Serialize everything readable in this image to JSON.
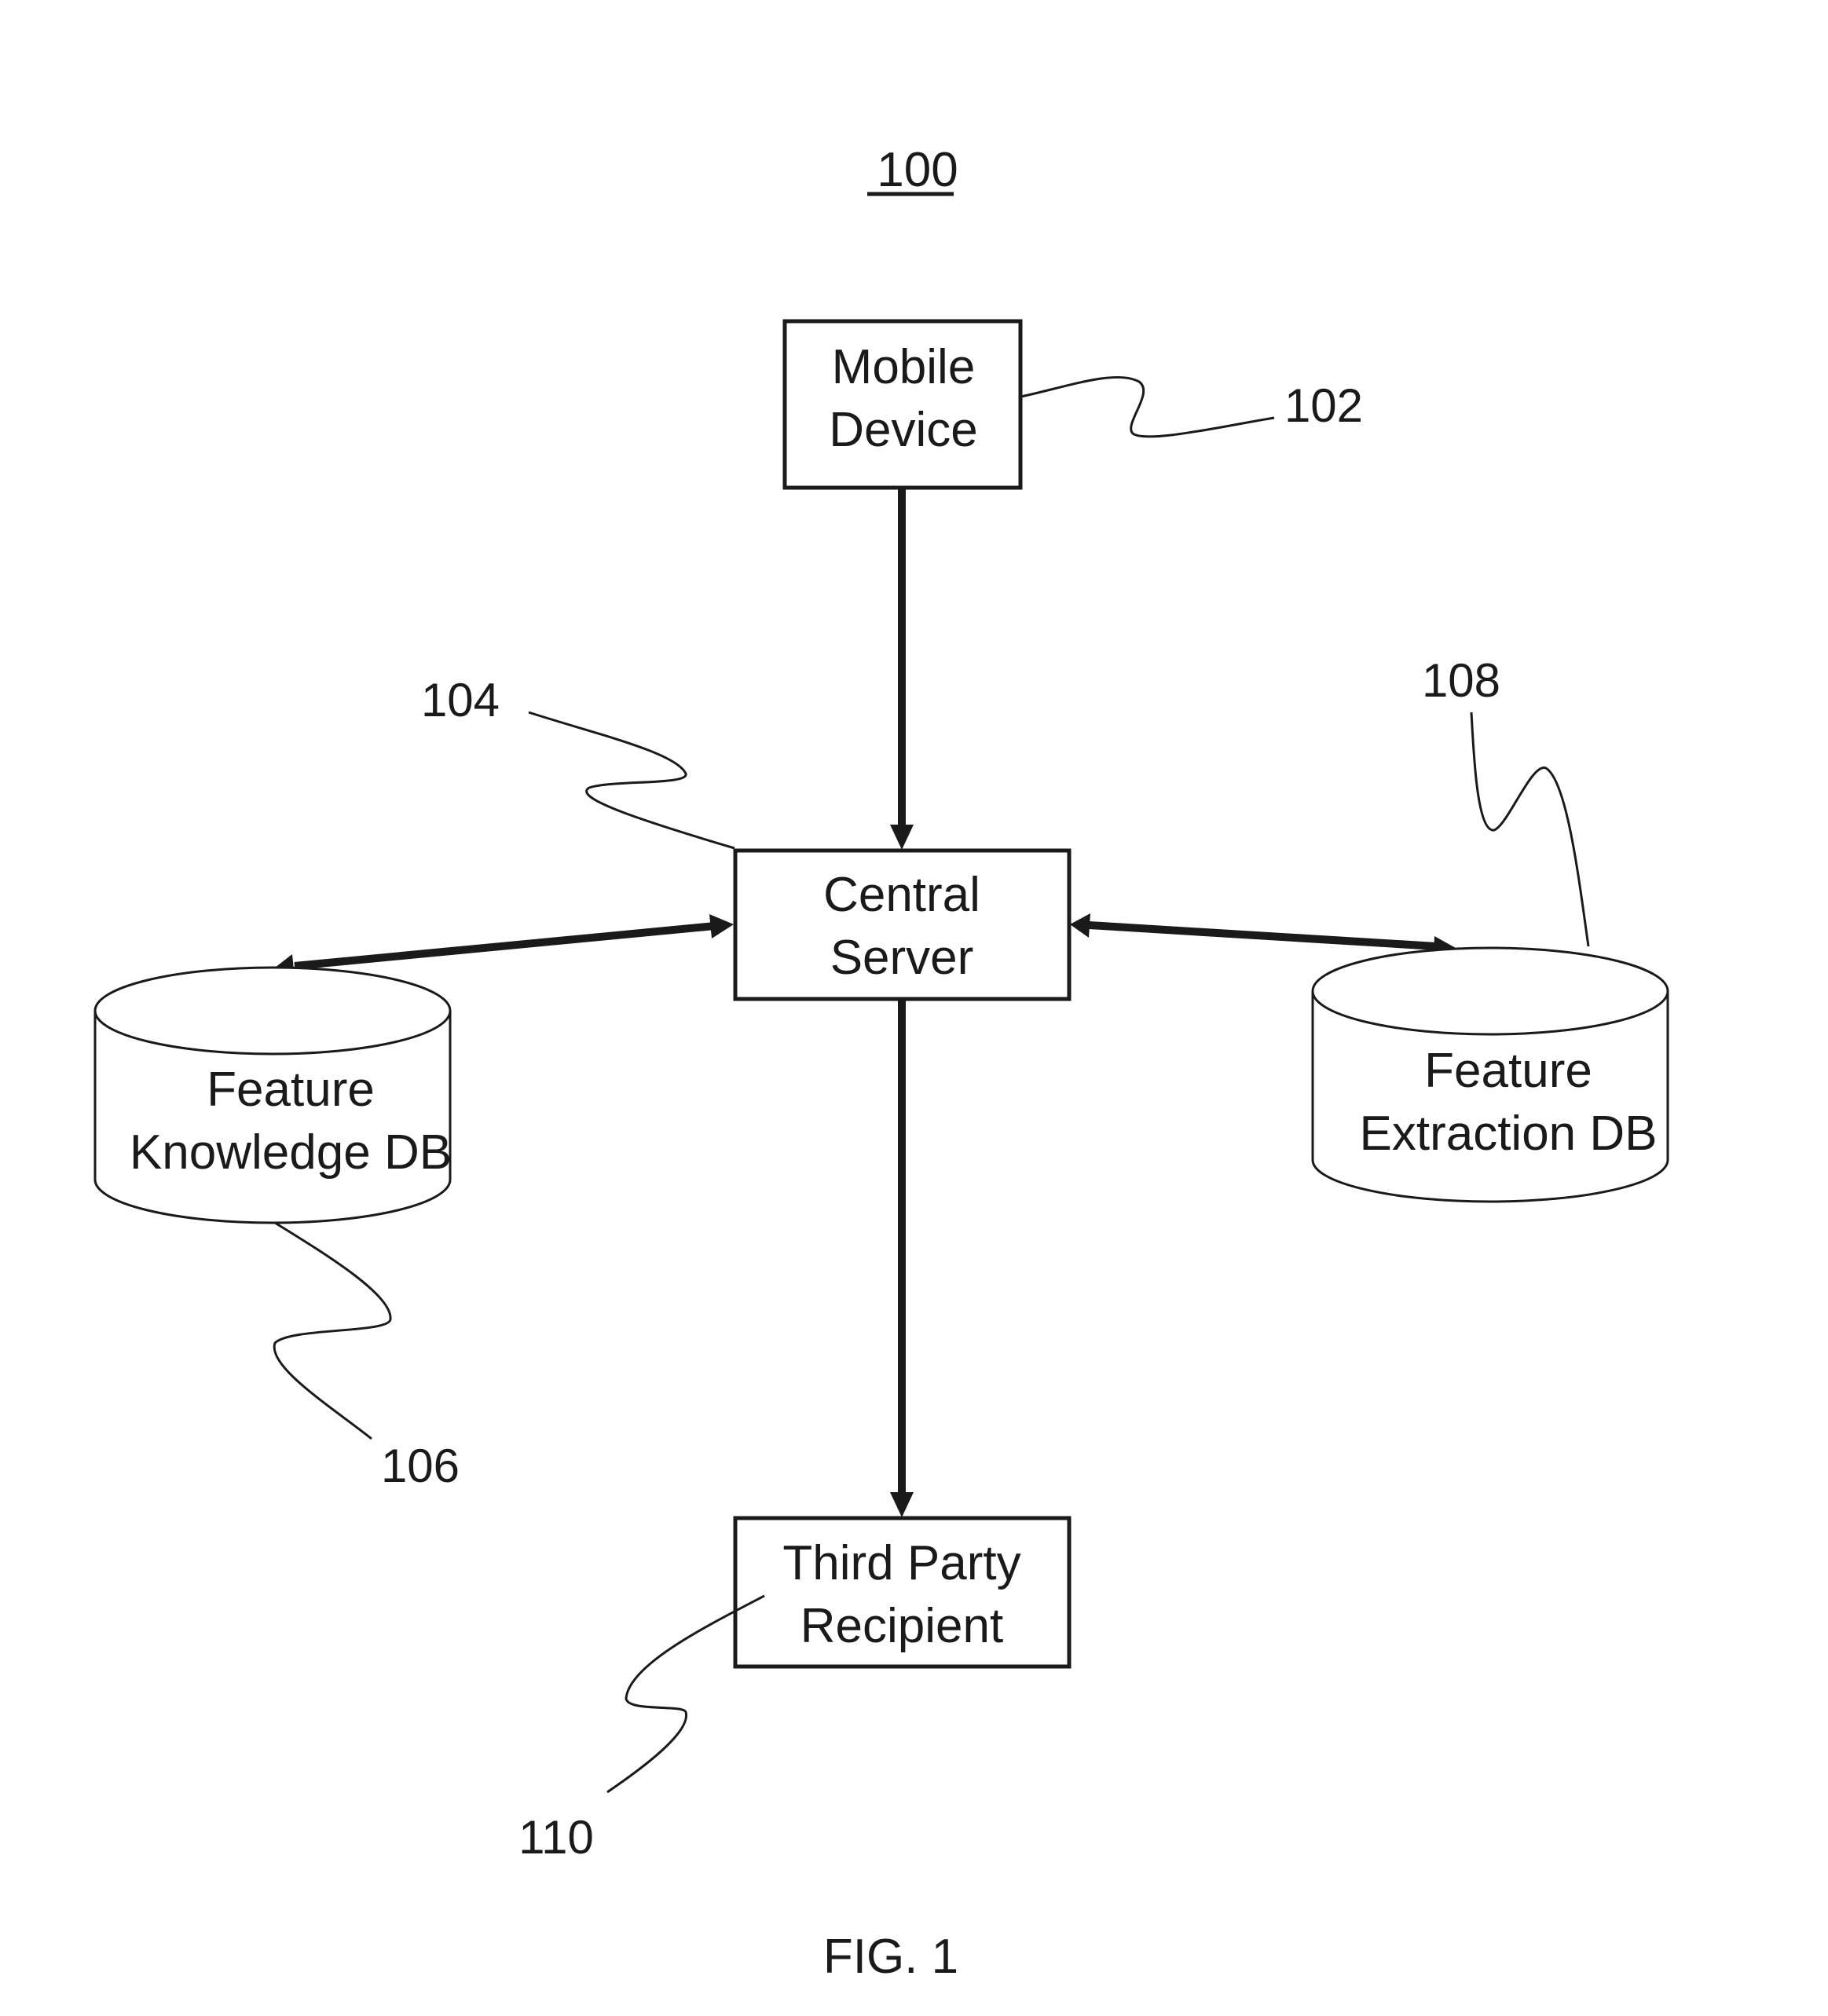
{
  "figure": {
    "reference_number": "100",
    "caption": "FIG. 1"
  },
  "nodes": {
    "mobile_device": {
      "line1": "Mobile",
      "line2": "Device",
      "ref": "102"
    },
    "central_server": {
      "line1": "Central",
      "line2": "Server",
      "ref": "104"
    },
    "feature_knowledge_db": {
      "line1": "Feature",
      "line2": "Knowledge DB",
      "ref": "106"
    },
    "feature_extraction_db": {
      "line1": "Feature",
      "line2": "Extraction DB",
      "ref": "108"
    },
    "third_party_recipient": {
      "line1": "Third Party",
      "line2": "Recipient",
      "ref": "110"
    }
  },
  "edges": [
    {
      "from": "Mobile Device",
      "to": "Central Server",
      "direction": "one-way"
    },
    {
      "from": "Central Server",
      "to": "Feature Knowledge DB",
      "direction": "two-way"
    },
    {
      "from": "Central Server",
      "to": "Feature Extraction DB",
      "direction": "two-way"
    },
    {
      "from": "Central Server",
      "to": "Third Party Recipient",
      "direction": "one-way"
    }
  ]
}
